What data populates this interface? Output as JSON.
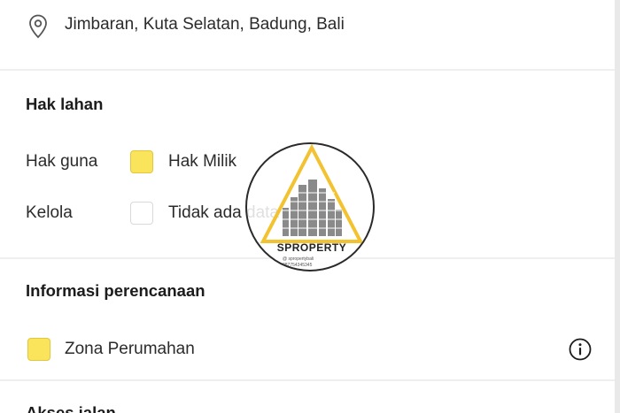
{
  "location": {
    "icon": "location-pin-icon",
    "text": "Jimbaran, Kuta Selatan, Badung, Bali"
  },
  "hak_lahan": {
    "title": "Hak lahan",
    "rows": [
      {
        "label": "Hak guna",
        "value": "Hak Milik",
        "marker": "filled",
        "color": "#f9e45c"
      },
      {
        "label": "Kelola",
        "value": "Tidak ada data",
        "marker": "empty"
      }
    ]
  },
  "informasi_perencanaan": {
    "title": "Informasi perencanaan",
    "zone": {
      "label": "Zona Perumahan",
      "color": "#f9e45c",
      "icon": "info-icon"
    }
  },
  "akses_jalan": {
    "title": "Akses jalan"
  },
  "watermark": {
    "brand": "SPROPERTY",
    "line1": "@ spropertybali",
    "line2": "087754345345"
  }
}
